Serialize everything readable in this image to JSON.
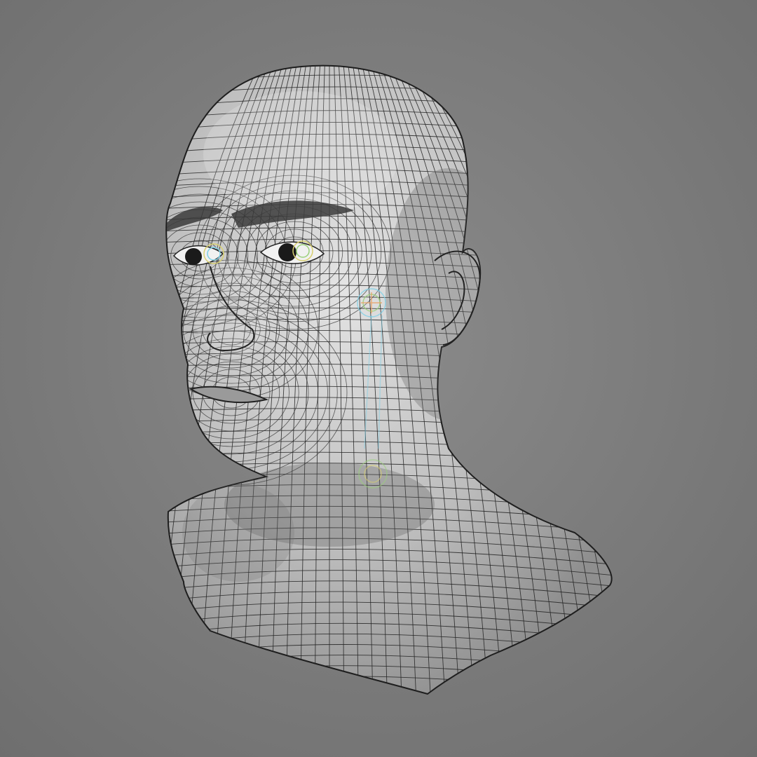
{
  "scene": {
    "background_center": "#8a8a8a",
    "background_edge": "#6e6e6e",
    "mesh_fill_light": "#e4e4e4",
    "mesh_fill_mid": "#bdbdbd",
    "mesh_fill_dark": "#8f8f8f",
    "wire_color": "#222222",
    "rig_colors": [
      "#d8d070",
      "#7fd0e6",
      "#9ad07a",
      "#e8a060"
    ],
    "icons": {
      "model": "head-bust-wireframe-icon",
      "rig": "facial-rig-controls-icon"
    }
  }
}
